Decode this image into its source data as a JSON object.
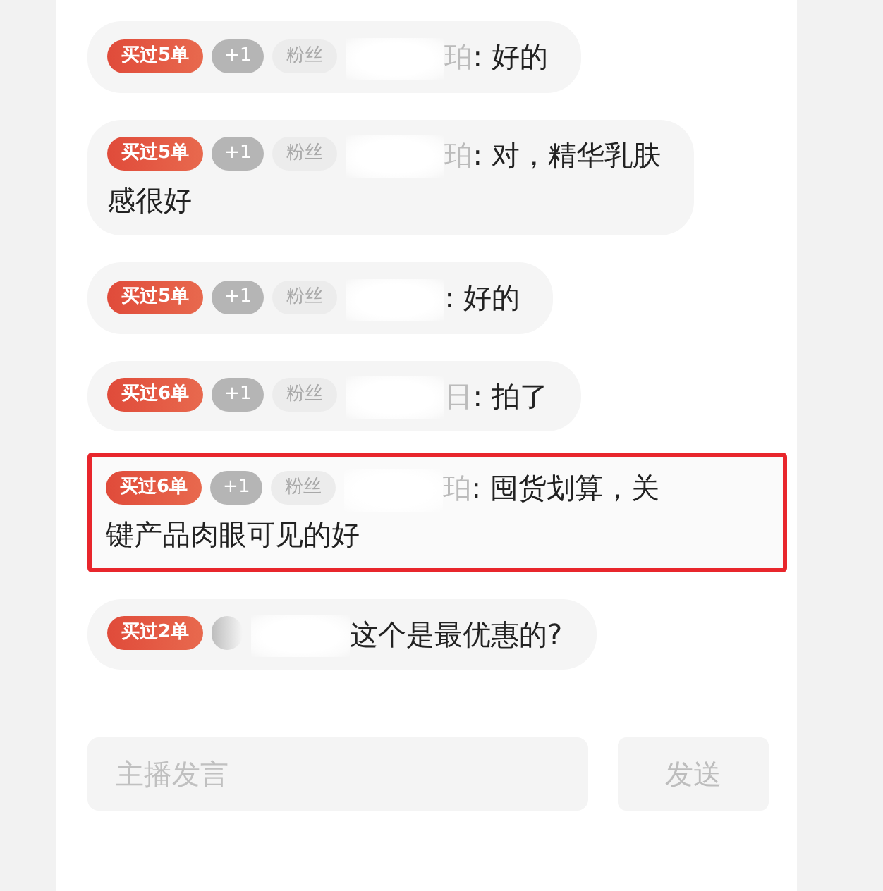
{
  "messages": [
    {
      "order_badge": "买过5单",
      "plus_badge": "+1",
      "fan_badge": "粉丝",
      "name_fragment": "珀",
      "text": ": 好的",
      "highlighted": false
    },
    {
      "order_badge": "买过5单",
      "plus_badge": "+1",
      "fan_badge": "粉丝",
      "name_fragment": "珀",
      "text": ": 对，精华乳肤",
      "continuation": "感很好",
      "highlighted": false
    },
    {
      "order_badge": "买过5单",
      "plus_badge": "+1",
      "fan_badge": "粉丝",
      "text": ": 好的",
      "highlighted": false
    },
    {
      "order_badge": "买过6单",
      "plus_badge": "+1",
      "fan_badge": "粉丝",
      "name_fragment": "日",
      "text": ": 拍了",
      "highlighted": false
    },
    {
      "order_badge": "买过6单",
      "plus_badge": "+1",
      "fan_badge": "粉丝",
      "name_fragment": "珀",
      "text": ": 囤货划算，关",
      "continuation": "键产品肉眼可见的好",
      "highlighted": true
    },
    {
      "order_badge": "买过2单",
      "text": "这个是最优惠的?",
      "highlighted": false
    }
  ],
  "composer": {
    "placeholder": "主播发言",
    "send_button": "发送"
  }
}
